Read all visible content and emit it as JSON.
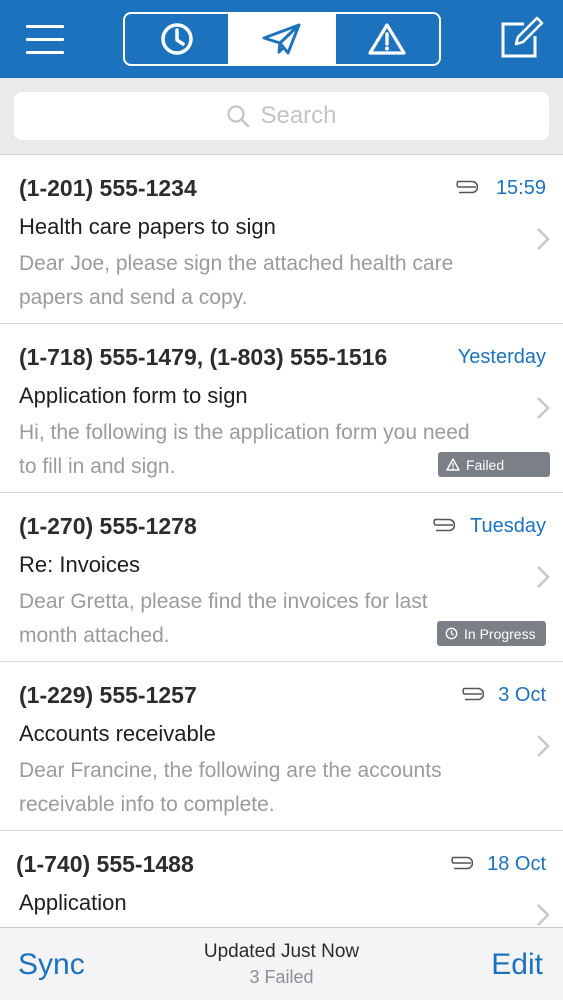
{
  "colors": {
    "accent": "#1d72bd",
    "navbar": "#1d72bd",
    "badge": "#7b7f86",
    "preview_text": "#9a9b9e",
    "search_bg": "#e9eaec"
  },
  "navbar": {
    "menu_icon": "hamburger-menu-icon",
    "compose_icon": "compose-icon",
    "segments": [
      {
        "icon": "clock-icon",
        "active": false
      },
      {
        "icon": "paper-plane-icon",
        "active": true
      },
      {
        "icon": "warning-icon",
        "active": false
      }
    ]
  },
  "search": {
    "placeholder": "Search",
    "icon": "search-icon"
  },
  "messages": [
    {
      "from": "(1-201) 555-1234",
      "date": "15:59",
      "attachment": true,
      "subject": "Health care papers to sign",
      "preview": "Dear Joe, please sign the attached health care papers and send a copy.",
      "badge": null
    },
    {
      "from": "(1-718) 555-1479, (1-803) 555-1516",
      "date": "Yesterday",
      "attachment": false,
      "subject": "Application form to sign",
      "preview": "Hi, the following is the application form you need to fill in and sign.",
      "badge": {
        "icon": "warning-icon",
        "label": "Failed"
      }
    },
    {
      "from": "(1-270) 555-1278",
      "date": "Tuesday",
      "attachment": true,
      "subject": "Re: Invoices",
      "preview": "Dear Gretta, please find the invoices for last month attached.",
      "badge": {
        "icon": "clock-icon",
        "label": "In Progress"
      }
    },
    {
      "from": "(1-229) 555-1257",
      "date": "3 Oct",
      "attachment": true,
      "subject": "Accounts receivable",
      "preview": "Dear Francine, the following are the accounts receivable info to complete.",
      "badge": null
    },
    {
      "from": "(1-740) 555-1488",
      "date": "18 Oct",
      "attachment": true,
      "subject": "Application",
      "preview": "",
      "badge": null
    }
  ],
  "bottombar": {
    "sync_label": "Sync",
    "edit_label": "Edit",
    "status_line1": "Updated Just Now",
    "status_line2": "3 Failed"
  }
}
